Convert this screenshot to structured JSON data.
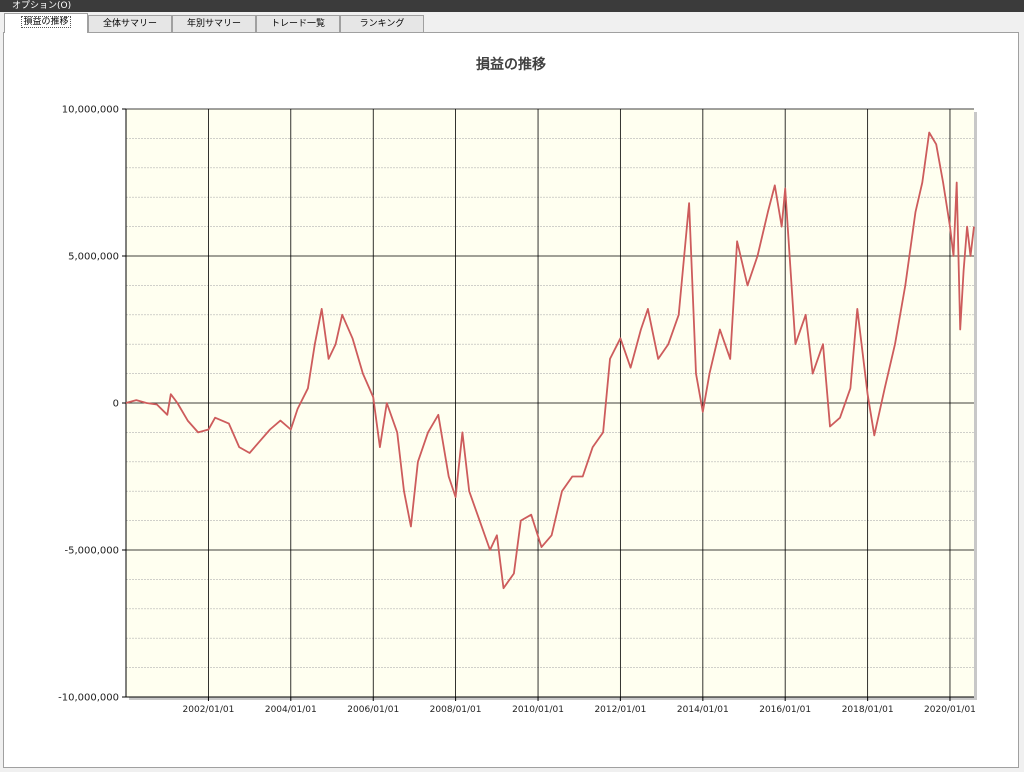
{
  "menu": {
    "options_label": "オプション(O)"
  },
  "tabs": [
    {
      "label": "損益の推移",
      "active": true
    },
    {
      "label": "全体サマリー",
      "active": false
    },
    {
      "label": "年別サマリー",
      "active": false
    },
    {
      "label": "トレード一覧",
      "active": false
    },
    {
      "label": "ランキング",
      "active": false
    }
  ],
  "colors": {
    "plot_background": "#fffff0",
    "line": "#cd5c5c",
    "major_grid": "#000000",
    "minor_grid": "#b4b4b4"
  },
  "chart_data": {
    "type": "line",
    "title": "損益の推移",
    "xlabel": "",
    "ylabel": "",
    "xlim": [
      "2000/01/01",
      "2020/08/01"
    ],
    "ylim": [
      -10000000,
      10000000
    ],
    "yticks": [
      {
        "value": 10000000,
        "label": "10,000,000"
      },
      {
        "value": 5000000,
        "label": "5,000,000"
      },
      {
        "value": 0,
        "label": "0"
      },
      {
        "value": -5000000,
        "label": "-5,000,000"
      },
      {
        "value": -10000000,
        "label": "-10,000,000"
      }
    ],
    "xticks": [
      "2002/01/01",
      "2004/01/01",
      "2006/01/01",
      "2008/01/01",
      "2010/01/01",
      "2012/01/01",
      "2014/01/01",
      "2016/01/01",
      "2018/01/01",
      "2020/01/01"
    ],
    "grid": true,
    "legend": "none",
    "series": [
      {
        "points": [
          [
            "2000/01/01",
            0
          ],
          [
            "2000/04/01",
            100000
          ],
          [
            "2000/07/01",
            0
          ],
          [
            "2000/10/01",
            -50000
          ],
          [
            "2001/01/01",
            -400000
          ],
          [
            "2001/02/01",
            300000
          ],
          [
            "2001/04/01",
            0
          ],
          [
            "2001/07/01",
            -600000
          ],
          [
            "2001/10/01",
            -1000000
          ],
          [
            "2002/01/01",
            -900000
          ],
          [
            "2002/03/01",
            -500000
          ],
          [
            "2002/07/01",
            -700000
          ],
          [
            "2002/10/01",
            -1500000
          ],
          [
            "2003/01/01",
            -1700000
          ],
          [
            "2003/04/01",
            -1300000
          ],
          [
            "2003/07/01",
            -900000
          ],
          [
            "2003/10/01",
            -600000
          ],
          [
            "2004/01/01",
            -900000
          ],
          [
            "2004/03/01",
            -200000
          ],
          [
            "2004/06/01",
            500000
          ],
          [
            "2004/08/01",
            2000000
          ],
          [
            "2004/10/01",
            3200000
          ],
          [
            "2004/12/01",
            1500000
          ],
          [
            "2005/02/01",
            2000000
          ],
          [
            "2005/04/01",
            3000000
          ],
          [
            "2005/07/01",
            2200000
          ],
          [
            "2005/10/01",
            1000000
          ],
          [
            "2006/01/01",
            200000
          ],
          [
            "2006/03/01",
            -1500000
          ],
          [
            "2006/05/01",
            0
          ],
          [
            "2006/08/01",
            -1000000
          ],
          [
            "2006/10/01",
            -3000000
          ],
          [
            "2006/12/01",
            -4200000
          ],
          [
            "2007/02/01",
            -2000000
          ],
          [
            "2007/05/01",
            -1000000
          ],
          [
            "2007/08/01",
            -400000
          ],
          [
            "2007/11/01",
            -2500000
          ],
          [
            "2008/01/01",
            -3200000
          ],
          [
            "2008/03/01",
            -1000000
          ],
          [
            "2008/05/01",
            -3000000
          ],
          [
            "2008/08/01",
            -4000000
          ],
          [
            "2008/11/01",
            -5000000
          ],
          [
            "2009/01/01",
            -4500000
          ],
          [
            "2009/03/01",
            -6300000
          ],
          [
            "2009/06/01",
            -5800000
          ],
          [
            "2009/08/01",
            -4000000
          ],
          [
            "2009/11/01",
            -3800000
          ],
          [
            "2010/02/01",
            -4900000
          ],
          [
            "2010/05/01",
            -4500000
          ],
          [
            "2010/08/01",
            -3000000
          ],
          [
            "2010/11/01",
            -2500000
          ],
          [
            "2011/02/01",
            -2500000
          ],
          [
            "2011/05/01",
            -1500000
          ],
          [
            "2011/08/01",
            -1000000
          ],
          [
            "2011/10/01",
            1500000
          ],
          [
            "2012/01/01",
            2200000
          ],
          [
            "2012/04/01",
            1200000
          ],
          [
            "2012/07/01",
            2500000
          ],
          [
            "2012/09/01",
            3200000
          ],
          [
            "2012/12/01",
            1500000
          ],
          [
            "2013/03/01",
            2000000
          ],
          [
            "2013/06/01",
            3000000
          ],
          [
            "2013/09/01",
            6800000
          ],
          [
            "2013/11/01",
            1000000
          ],
          [
            "2014/01/01",
            -300000
          ],
          [
            "2014/03/01",
            1000000
          ],
          [
            "2014/06/01",
            2500000
          ],
          [
            "2014/09/01",
            1500000
          ],
          [
            "2014/11/01",
            5500000
          ],
          [
            "2015/02/01",
            4000000
          ],
          [
            "2015/05/01",
            5000000
          ],
          [
            "2015/08/01",
            6500000
          ],
          [
            "2015/10/01",
            7400000
          ],
          [
            "2015/12/01",
            6000000
          ],
          [
            "2016/01/01",
            7300000
          ],
          [
            "2016/04/01",
            2000000
          ],
          [
            "2016/07/01",
            3000000
          ],
          [
            "2016/09/01",
            1000000
          ],
          [
            "2016/12/01",
            2000000
          ],
          [
            "2017/02/01",
            -800000
          ],
          [
            "2017/05/01",
            -500000
          ],
          [
            "2017/08/01",
            500000
          ],
          [
            "2017/10/01",
            3200000
          ],
          [
            "2018/01/01",
            300000
          ],
          [
            "2018/03/01",
            -1100000
          ],
          [
            "2018/06/01",
            500000
          ],
          [
            "2018/09/01",
            2000000
          ],
          [
            "2018/12/01",
            4000000
          ],
          [
            "2019/03/01",
            6500000
          ],
          [
            "2019/05/01",
            7500000
          ],
          [
            "2019/07/01",
            9200000
          ],
          [
            "2019/09/01",
            8800000
          ],
          [
            "2019/11/01",
            7500000
          ],
          [
            "2020/01/01",
            6000000
          ],
          [
            "2020/02/01",
            5000000
          ],
          [
            "2020/03/01",
            7500000
          ],
          [
            "2020/04/01",
            2500000
          ],
          [
            "2020/05/01",
            4500000
          ],
          [
            "2020/06/01",
            6000000
          ],
          [
            "2020/07/01",
            5000000
          ],
          [
            "2020/08/01",
            6000000
          ]
        ]
      }
    ]
  }
}
